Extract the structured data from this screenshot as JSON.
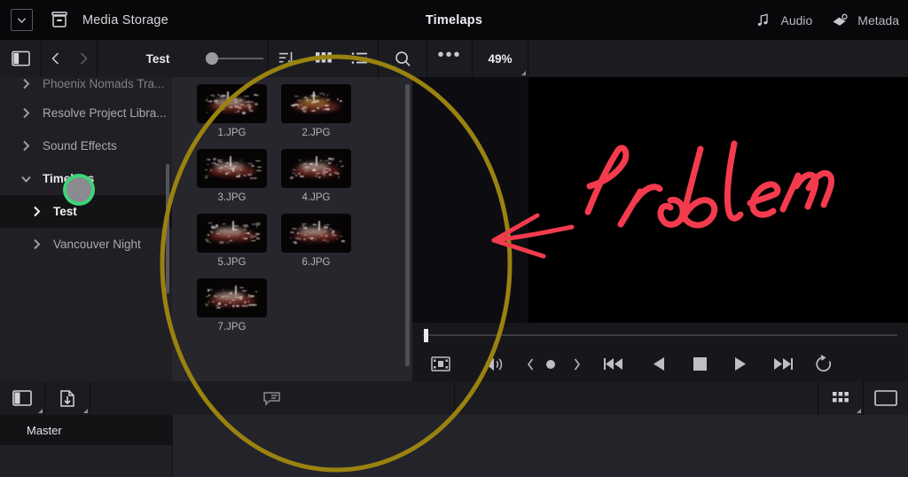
{
  "app": {
    "window_title": "Timelaps",
    "storage_label": "Media Storage",
    "dropdown_icon": "chevron-down-icon",
    "media_storage_icon": "archive-box-icon"
  },
  "titlebar_right": [
    {
      "label": "Audio",
      "icon": "music-note-icon"
    },
    {
      "label": "Metada",
      "icon": "metadata-tag-icon"
    }
  ],
  "toolbar": {
    "panel_toggle_icon": "sidebar-toggle-icon",
    "back_icon": "chevron-left-icon",
    "forward_icon": "chevron-right-icon",
    "breadcrumb": "Test",
    "slider_value": "0",
    "sort_icon": "sort-descending-icon",
    "grid_view_icon": "grid-view-icon",
    "list_view_icon": "list-view-icon",
    "search_icon": "search-icon",
    "more_label": "•••",
    "zoom_level": "49%"
  },
  "sidebar": {
    "items": [
      {
        "label": "Phoenix Nomads Tra...",
        "state": "collapsed",
        "level": 1,
        "clipped": true
      },
      {
        "label": "Resolve Project Libra...",
        "state": "collapsed",
        "level": 1
      },
      {
        "label": "Sound Effects",
        "state": "collapsed",
        "level": 1
      },
      {
        "label": "Timelaps",
        "state": "expanded",
        "level": 1
      },
      {
        "label": "Test",
        "state": "collapsed",
        "level": 2,
        "selected": true
      },
      {
        "label": "Vancouver Night",
        "state": "collapsed",
        "level": 2
      }
    ]
  },
  "browser": {
    "thumbnails": [
      {
        "label": "1.JPG"
      },
      {
        "label": "2.JPG"
      },
      {
        "label": "3.JPG"
      },
      {
        "label": "4.JPG"
      },
      {
        "label": "5.JPG"
      },
      {
        "label": "6.JPG"
      },
      {
        "label": "7.JPG"
      }
    ]
  },
  "viewer": {
    "transport": [
      {
        "name": "filmstrip-icon"
      },
      {
        "name": "volume-icon"
      },
      {
        "name": "step-back-icon"
      },
      {
        "name": "record-dot-icon"
      },
      {
        "name": "step-forward-icon"
      },
      {
        "name": "skip-to-start-icon"
      },
      {
        "name": "play-reverse-icon"
      },
      {
        "name": "stop-icon"
      },
      {
        "name": "play-icon"
      },
      {
        "name": "skip-to-end-icon"
      },
      {
        "name": "loop-icon"
      }
    ]
  },
  "bottombar": {
    "panel_toggle_icon": "sidebar-toggle-icon",
    "import_icon": "file-import-icon",
    "comment_icon": "comment-bubble-icon",
    "grid_icon": "grid-view-icon",
    "panel_icon": "panel-layout-icon"
  },
  "footer": {
    "master_label": "Master"
  },
  "annotations": {
    "note_text": "Problem",
    "note_color": "#f43b4e",
    "circle_color": "#9a8210",
    "cursor_ring_color": "#3ed47a"
  },
  "colors": {
    "titlebar_bg": "#08080a",
    "toolbar_bg": "#1c1c20",
    "sidebar_bg": "#202024",
    "browser_bg": "#26262c",
    "viewer_bg": "#0f0f13",
    "selected_row_bg": "#131316"
  }
}
